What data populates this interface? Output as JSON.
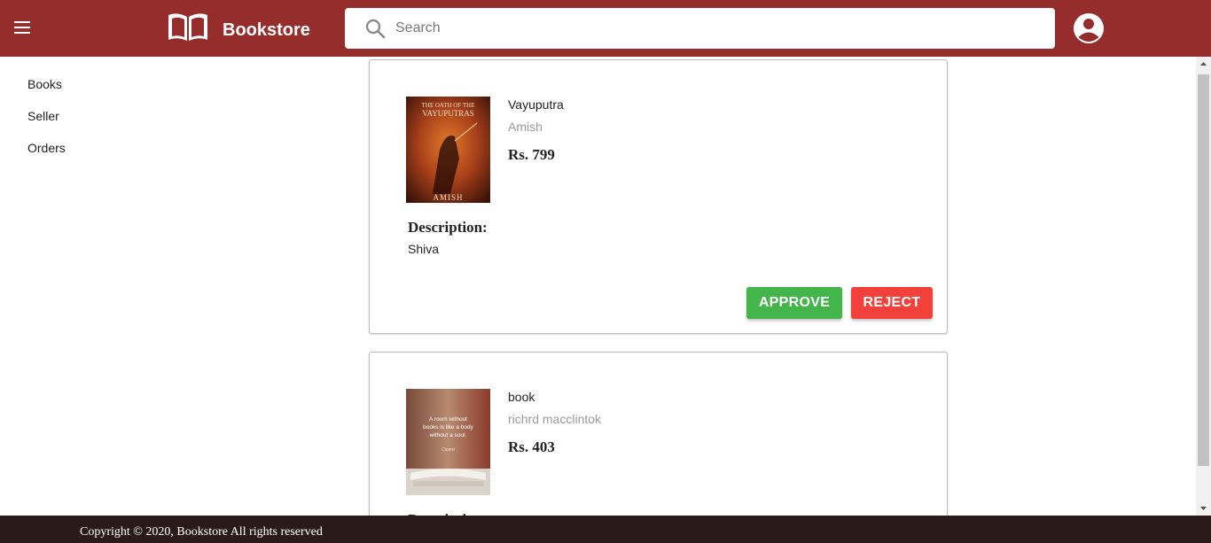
{
  "header": {
    "brand": "Bookstore",
    "search_placeholder": "Search",
    "background": "#962d2d"
  },
  "sidebar": {
    "items": [
      {
        "label": "Books"
      },
      {
        "label": "Seller"
      },
      {
        "label": "Orders"
      }
    ]
  },
  "books": [
    {
      "title": "Vayuputra",
      "author": "Amish",
      "price": "Rs. 799",
      "description_label": "Description:",
      "description": "Shiva",
      "cover_title_line1": "THE OATH OF THE",
      "cover_title_line2": "VAYUPUTRAS",
      "cover_author": "AMISH",
      "approve_label": "APPROVE",
      "reject_label": "REJECT"
    },
    {
      "title": "book",
      "author": "richrd macclintok",
      "price": "Rs. 403",
      "cover_quote": [
        "A room without",
        "books is like a body",
        "without a soul."
      ],
      "cover_attribution": "Cicero"
    }
  ],
  "colors": {
    "approve": "#43b54a",
    "reject": "#f2413a",
    "footer": "#2b1a1a"
  },
  "footer": {
    "text": "Copyright © 2020, Bookstore All rights reserved"
  }
}
